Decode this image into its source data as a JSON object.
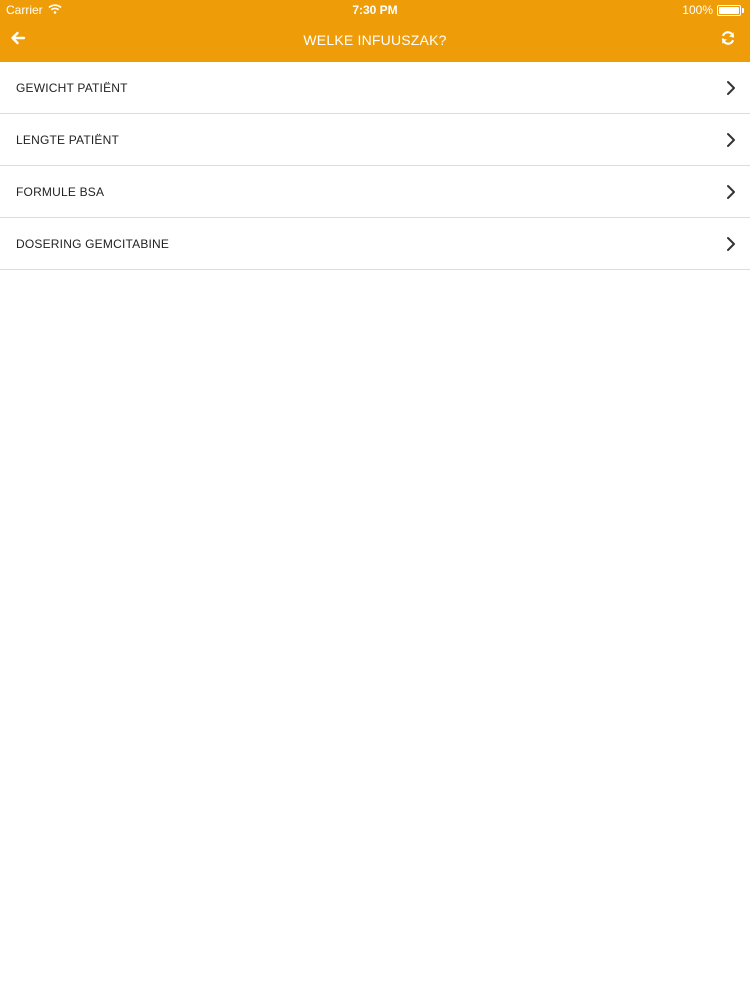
{
  "status_bar": {
    "carrier": "Carrier",
    "time": "7:30 PM",
    "battery": "100%"
  },
  "nav": {
    "title": "WELKE INFUUSZAK?",
    "back_icon": "arrow-left-icon",
    "refresh_icon": "refresh-icon",
    "accent_color": "#ee9d09"
  },
  "list": {
    "items": [
      {
        "label": "GEWICHT PATIËNT"
      },
      {
        "label": "LENGTE PATIËNT"
      },
      {
        "label": "FORMULE BSA"
      },
      {
        "label": "DOSERING GEMCITABINE"
      }
    ]
  }
}
